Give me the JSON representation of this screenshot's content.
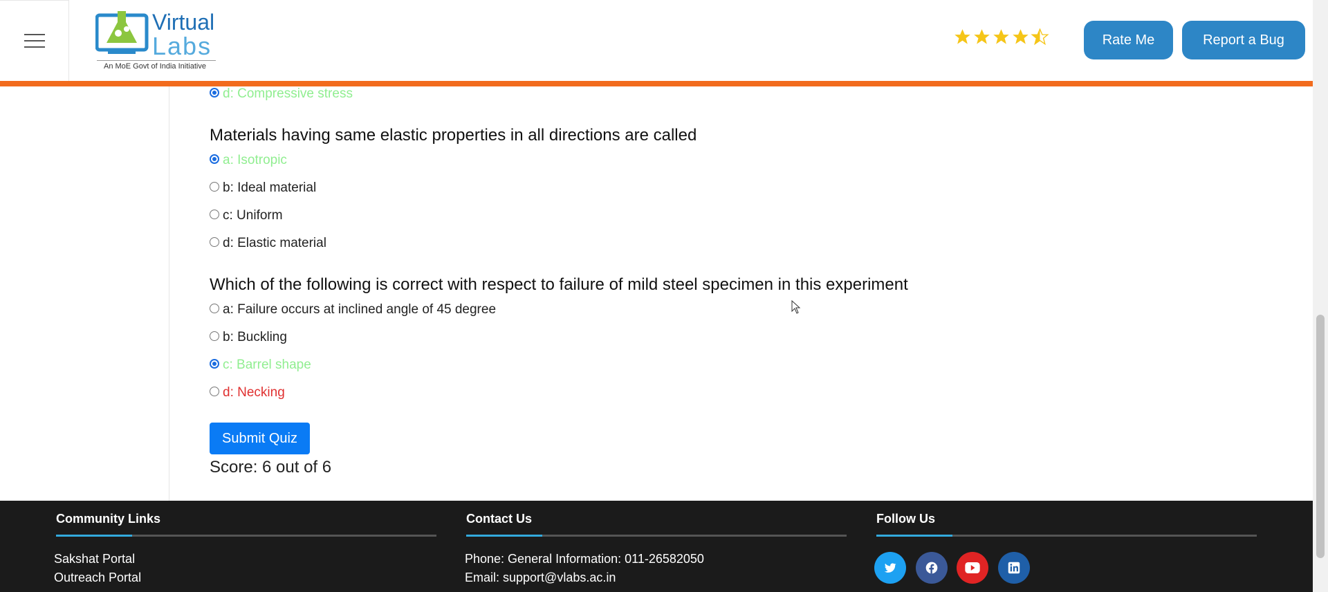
{
  "header": {
    "logo": {
      "word1": "Virtual",
      "word2": "Labs",
      "tagline": "An MoE Govt of India Initiative"
    },
    "rating": {
      "value": 4.5,
      "max": 5
    },
    "rate_label": "Rate Me",
    "bug_label": "Report a Bug",
    "accent_color": "#f26b1d",
    "button_color": "#2d86c6"
  },
  "quiz": {
    "prev_option": "d: Compressive stress",
    "questions": [
      {
        "text": "Materials having same elastic properties in all directions are called",
        "options": [
          {
            "label": "a: Isotropic",
            "selected": true,
            "status": "correct"
          },
          {
            "label": "b: Ideal material",
            "selected": false,
            "status": "normal"
          },
          {
            "label": "c: Uniform",
            "selected": false,
            "status": "normal"
          },
          {
            "label": "d: Elastic material",
            "selected": false,
            "status": "normal"
          }
        ]
      },
      {
        "text": "Which of the following is correct with respect to failure of mild steel specimen in this experiment",
        "options": [
          {
            "label": "a: Failure occurs at inclined angle of 45 degree",
            "selected": false,
            "status": "normal"
          },
          {
            "label": "b: Buckling",
            "selected": false,
            "status": "normal"
          },
          {
            "label": "c: Barrel shape",
            "selected": true,
            "status": "correct"
          },
          {
            "label": "d: Necking",
            "selected": false,
            "status": "wrong"
          }
        ]
      }
    ],
    "submit_label": "Submit Quiz",
    "score": "Score: 6 out of 6",
    "colors": {
      "correct": "#90ee90",
      "wrong": "#e03030",
      "submit": "#0a7bf5"
    }
  },
  "footer": {
    "community": {
      "title": "Community Links",
      "links": [
        "Sakshat Portal",
        "Outreach Portal"
      ]
    },
    "contact": {
      "title": "Contact Us",
      "phone": "Phone: General Information: 011-26582050",
      "email": "Email: support@vlabs.ac.in"
    },
    "follow": {
      "title": "Follow Us",
      "icons": [
        "twitter-icon",
        "facebook-icon",
        "youtube-icon",
        "linkedin-icon"
      ]
    },
    "background": "#1b1b1b",
    "line_accent": "#33aadd"
  }
}
